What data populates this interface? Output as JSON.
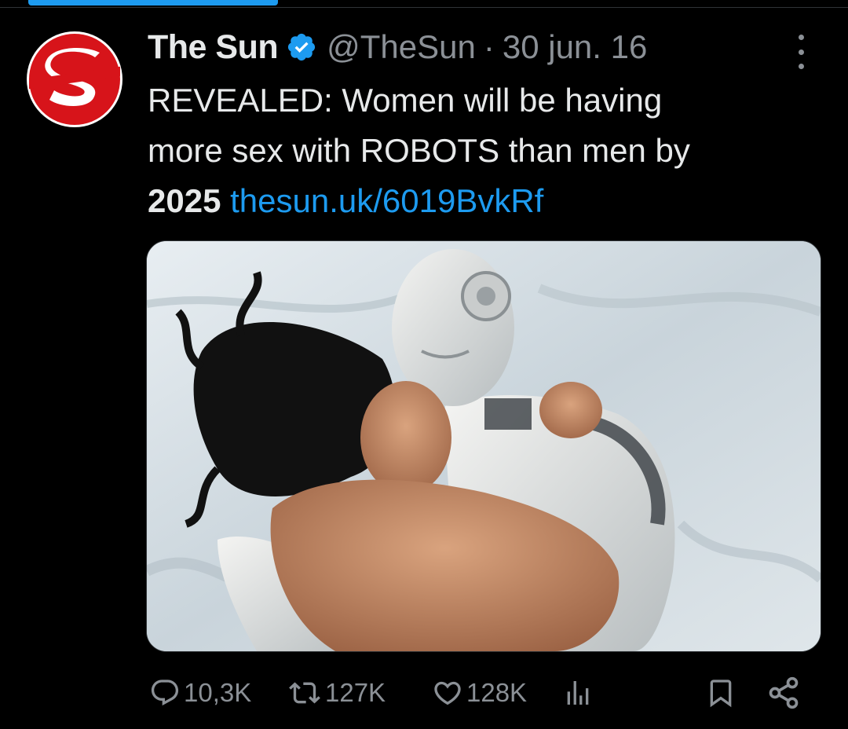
{
  "tweet": {
    "display_name": "The Sun",
    "verified": true,
    "handle": "@TheSun",
    "separator": "·",
    "date": "30 jun. 16",
    "avatar_letter": "S",
    "text": {
      "line1": "REVEALED: Women will be having",
      "line2": "more sex with ROBOTS than men by",
      "line3_bold": "2025",
      "link": "thesun.uk/6019BvkRf"
    },
    "media": {
      "alt": "Photo of a woman with dark hair lying on white sheets embracing a white humanoid robot"
    }
  },
  "actions": {
    "replies": "10,3K",
    "reposts": "127K",
    "likes": "128K"
  },
  "colors": {
    "background": "#000000",
    "text_primary": "#e7e9ea",
    "text_secondary": "#8b9096",
    "accent": "#1d9bf0",
    "brand_red": "#d7141a"
  },
  "icons": {
    "reply": "reply-icon",
    "repost": "repost-icon",
    "like": "heart-icon",
    "views": "views-icon",
    "bookmark": "bookmark-icon",
    "share": "share-icon",
    "more": "more-icon",
    "verified": "verified-badge-icon"
  }
}
